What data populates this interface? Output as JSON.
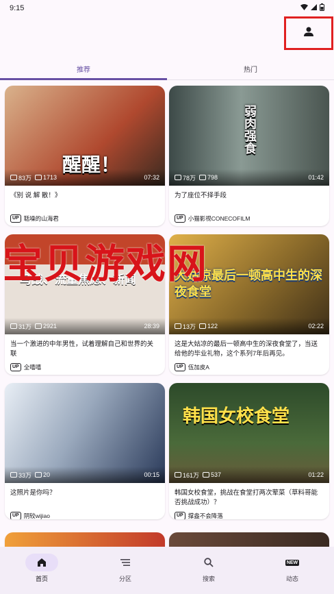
{
  "status_bar": {
    "time": "9:15"
  },
  "tabs": [
    {
      "label": "推荐",
      "active": true
    },
    {
      "label": "热门",
      "active": false
    }
  ],
  "cards": [
    {
      "title": "《别 说 解 散！》",
      "views": "83万",
      "danmaku": "1713",
      "duration": "07:32",
      "author": "聒噪的山海君",
      "thumb_text": "醒醒！",
      "thumb_color": "#b0492f"
    },
    {
      "title": "为了座位不择手段",
      "views": "78万",
      "danmaku": "798",
      "duration": "01:42",
      "author": "小猫影视CONECOFILM",
      "thumb_text": "弱肉强食",
      "thumb_color": "#5a6b66"
    },
    {
      "title": "当一个激进的中年男性，试着理解自己和世界的关联",
      "views": "31万",
      "danmaku": "2921",
      "duration": "28:39",
      "author": "全嘻嘻",
      "thumb_text": "马战、流量焦虑、新闻",
      "thumb_color": "#c2452a"
    },
    {
      "title": "这是大姑凉的最后一顿高中生的深夜食堂了，当送给他的毕业礼物，这个系列7年后再见。",
      "views": "13万",
      "danmaku": "122",
      "duration": "02:22",
      "author": "伍加皮A",
      "thumb_text": "大姑凉最后一顿高中生的深夜食堂",
      "thumb_color": "#8a6a2a"
    },
    {
      "title": "这照片是你吗？",
      "views": "33万",
      "danmaku": "20",
      "duration": "00:15",
      "author": "阴较wijiao",
      "thumb_text": "",
      "thumb_color": "#7a8ea6"
    },
    {
      "title": "韩国女校食堂，挑战在食堂打两次荤菜（草料哥能否挑战成功）？",
      "views": "161万",
      "danmaku": "537",
      "duration": "01:22",
      "author": "撑盎不会降落",
      "thumb_text": "韩国女校食堂",
      "thumb_color": "#2d4a2a"
    }
  ],
  "watermark": "宝贝游戏网",
  "bottom_nav": [
    {
      "label": "首页",
      "icon": "home-icon",
      "active": true
    },
    {
      "label": "分区",
      "icon": "menu-icon",
      "active": false
    },
    {
      "label": "搜索",
      "icon": "search-icon",
      "active": false
    },
    {
      "label": "动态",
      "icon": "new-icon",
      "active": false
    }
  ],
  "colors": {
    "accent": "#6750a4",
    "highlight_border": "#e02020",
    "watermark": "#d8141a"
  }
}
